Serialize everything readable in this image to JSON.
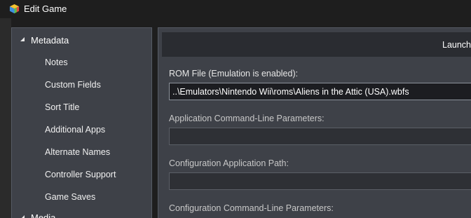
{
  "window": {
    "title": "Edit Game",
    "icon": "launchbox-cube-icon"
  },
  "backdrop": {
    "cut_text": "n"
  },
  "sidebar": {
    "group": {
      "label": "Metadata",
      "expanded": true
    },
    "items": [
      {
        "label": "Notes"
      },
      {
        "label": "Custom Fields"
      },
      {
        "label": "Sort Title"
      },
      {
        "label": "Additional Apps"
      },
      {
        "label": "Alternate Names"
      },
      {
        "label": "Controller Support"
      },
      {
        "label": "Game Saves"
      }
    ],
    "next_group": {
      "label": "Media",
      "expanded": true
    }
  },
  "main": {
    "section_header": "Launching",
    "fields": [
      {
        "label": "ROM File (Emulation is enabled):",
        "value": "..\\Emulators\\Nintendo Wii\\roms\\Aliens in the Attic (USA).wbfs"
      },
      {
        "label": "Application Command-Line Parameters:",
        "value": ""
      },
      {
        "label": "Configuration Application Path:",
        "value": ""
      },
      {
        "label": "Configuration Command-Line Parameters:",
        "value": ""
      }
    ]
  },
  "colors": {
    "window_bg": "#1e1e1e",
    "panel_bg": "#3e4148",
    "header_bg": "#2a2c31",
    "input_bg": "#2e3035",
    "active_input_bg": "#1c1d21",
    "text": "#ffffff"
  }
}
